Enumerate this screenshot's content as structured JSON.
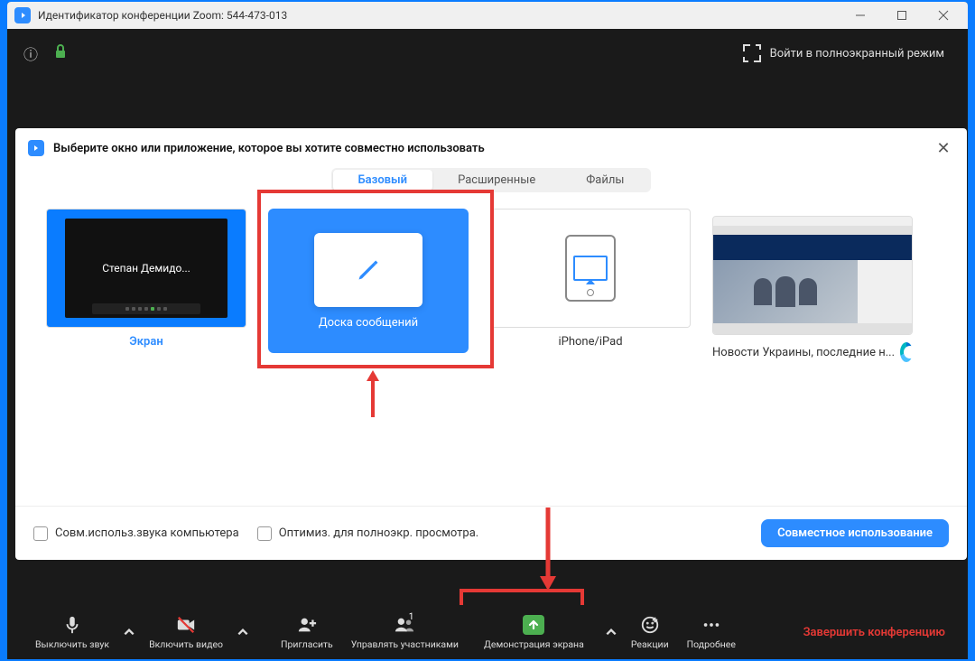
{
  "titlebar": {
    "text": "Идентификатор конференции Zoom: 544-473-013"
  },
  "topbar": {
    "fullscreen_label": "Войти в полноэкранный режим"
  },
  "dialog": {
    "title": "Выберите окно или приложение, которое вы хотите совместно использовать",
    "tabs": {
      "basic": "Базовый",
      "advanced": "Расширенные",
      "files": "Файлы"
    },
    "cards": {
      "screen": {
        "label": "Экран",
        "meeting_name": "Степан  Демидо..."
      },
      "whiteboard": {
        "label": "Доска сообщений"
      },
      "iphone": {
        "label": "iPhone/iPad"
      },
      "news": {
        "label": "Новости Украины, последние н..."
      }
    },
    "footer": {
      "share_audio": "Совм.использ.звука компьютера",
      "optimize": "Оптимиз. для полноэкр. просмотра.",
      "share_button": "Совместное использование"
    }
  },
  "toolbar": {
    "mute": "Выключить звук",
    "video": "Включить видео",
    "invite": "Пригласить",
    "participants": "Управлять участниками",
    "participants_count": "1",
    "share": "Демонстрация экрана",
    "reactions": "Реакции",
    "more": "Подробнее",
    "end": "Завершить конференцию"
  }
}
